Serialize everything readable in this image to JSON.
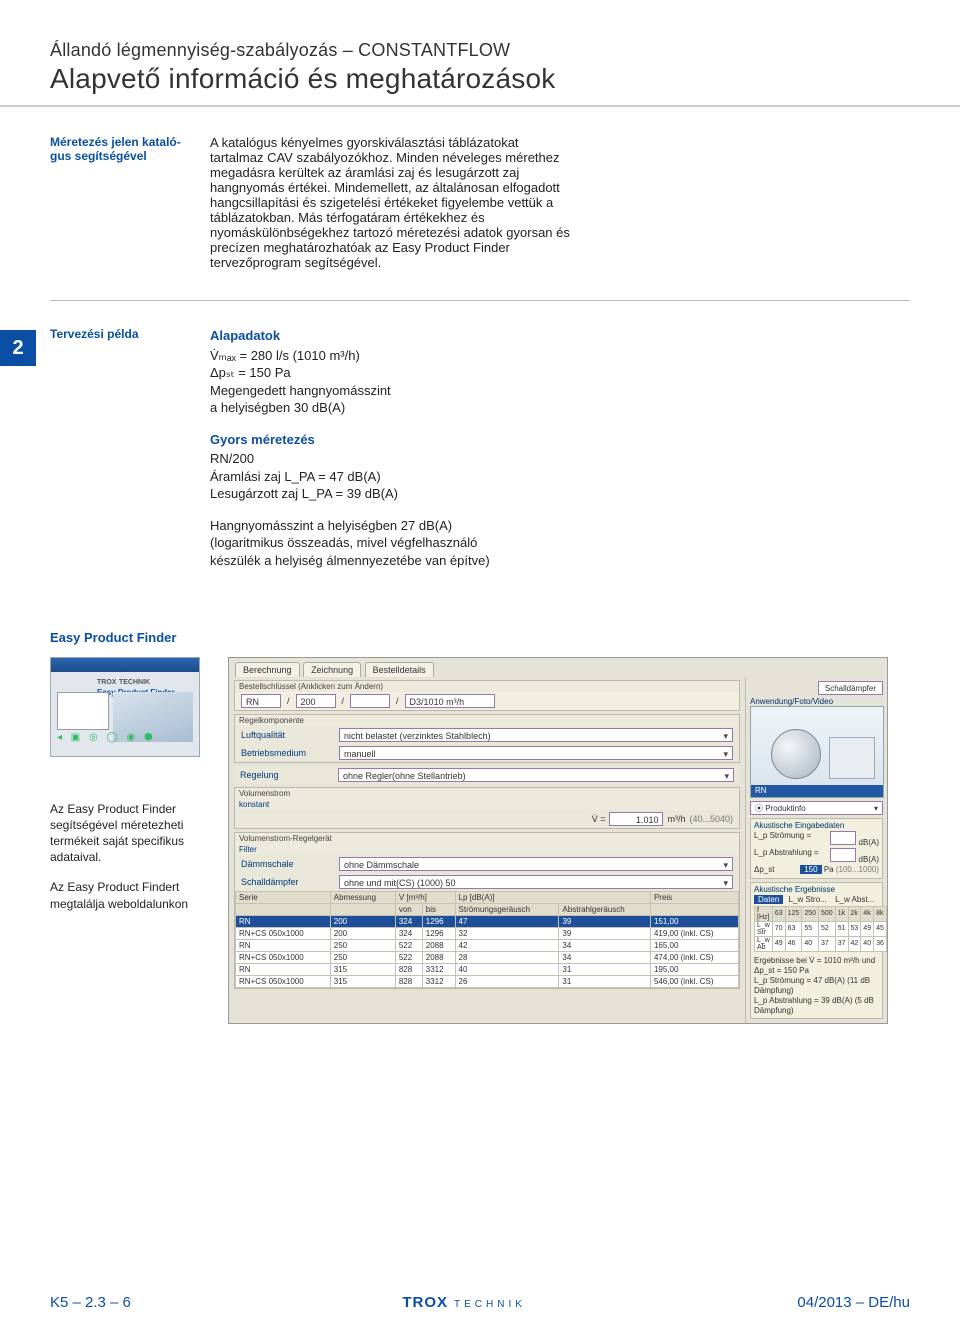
{
  "header": {
    "small": "Állandó légmennyiség-szabályozás – CONSTANTFLOW",
    "big": "Alapvető információ és meghatározások"
  },
  "page_tab": "2",
  "sec1": {
    "label": "Méretezés jelen kataló­gus segítségével",
    "text": "A katalógus kényelmes gyorskiválasztási táblázatokat tartalmaz CAV szabályozókhoz. Minden néveleges mérethez megadásra kerültek az áramlási zaj és lesugárzott zaj hangnyomás értékei. Mindemellett, az általánosan elfogadott hangcsillapítási és szigetelési értékeket figyelembe vettük a táblázatokban. Más térfogatáram értékekhez és nyomáskülönbségekhez tartozó méretezési adatok gyorsan és precízen meghatározhatóak az Easy Product Finder tervezőprogram segítségével."
  },
  "sec2": {
    "label": "Tervezési példa",
    "alap_title": "Alapadatok",
    "alap": {
      "vmax": "V̇ₘₐₓ = 280 l/s (1010 m³/h)",
      "dpst": "Δpₛₜ = 150 Pa",
      "meg1": "Megengedett hangnyomásszint",
      "meg2": "a helyiségben 30 dB(A)"
    },
    "gyors_title": "Gyors méretezés",
    "gyors": {
      "rn": "RN/200",
      "aram": "Áramlási zaj L_PA = 47 dB(A)",
      "lesu": "Lesugárzott zaj L_PA = 39 dB(A)"
    },
    "hang": {
      "l1": "Hangnyomásszint a helyiségben 27 dB(A)",
      "l2": "(logaritmikus összeadás, mivel végfelhasználó",
      "l3": "készülék a helyiség álmennyezetébe van építve)"
    }
  },
  "epf": {
    "heading": "Easy Product Finder",
    "thumb_brand": "TROX",
    "thumb_tech": "TECHNIK",
    "thumb_epf": "Easy Product Finder",
    "cap1": "Az Easy Product Finder segítségével méretezheti termékeit saját specifikus adataival.",
    "cap2": "Az Easy Product Findert megtalálja weboldalunkon"
  },
  "app": {
    "tabs": [
      "Berechnung",
      "Zeichnung",
      "Bestelldetails"
    ],
    "schald_btn": "Schalldämpfer",
    "bs_label": "Bestellschlüssel (Anklicken zum Ändern)",
    "bs_parts": [
      "RN",
      "/",
      "200",
      "/",
      "/",
      "/",
      "D3/1010 m³/h"
    ],
    "grp_regel": "Regelkomponente",
    "luft_label": "Luftqualität",
    "luft_value": "nicht belastet (verzinktes Stahlblech)",
    "betr_label": "Betriebsmedium",
    "betr_value": "manuell",
    "regel_label": "Regelung",
    "regel_value": "ohne Regler(ohne Stellantrieb)",
    "vol_grp": "Volumenstrom",
    "vol_sub": "konstant",
    "vol_veq": "V̇ =",
    "vol_val": "1.010",
    "vol_unit": "m³/h",
    "vol_range": "(40...5040)",
    "anwendung": "Anwendung/Foto/Video",
    "photo_cap": "RN",
    "prodinfo": "⦿ Produktinfo",
    "ak_in": "Akustische Eingabedaten",
    "ak_in_rows": {
      "ls": "L_p Strömung =",
      "ls_u": "dB(A)",
      "la": "L_p Abstrahlung =",
      "la_u": "dB(A)",
      "dp": "Δp_st",
      "dp_val": "150",
      "dp_u": "Pa",
      "dp_range": "(100...1000)"
    },
    "fr_grp": "Volumenstrom-Regelgerät",
    "fr_filter": "Filter",
    "damm_label": "Dämmschale",
    "damm_value": "ohne Dämmschale",
    "schall_label": "Schalldämpfer",
    "schall_value": "ohne und mit(CS) (1000) 50",
    "ak_out": "Akustische Ergebnisse",
    "ak_out_tabs": [
      "Daten",
      "L_w Stro...",
      "L_w Abst..."
    ],
    "spec_head": [
      "f [Hz]",
      "63",
      "125",
      "250",
      "500",
      "1k",
      "2k",
      "4k",
      "8k"
    ],
    "spec_r1": [
      "L_w Str",
      "70",
      "63",
      "55",
      "52",
      "51",
      "53",
      "49",
      "45"
    ],
    "spec_r2": [
      "L_w Ab",
      "49",
      "46",
      "40",
      "37",
      "37",
      "42",
      "40",
      "36"
    ],
    "result_title": "Ergebnisse bei V̇ = 1010 m³/h und Δp_st = 150 Pa",
    "result_l1": "L_p Strömung = 47 dB(A) (11 dB Dämpfung)",
    "result_l2": "L_p Abstrahlung = 39 dB(A) (5 dB Dämpfung)",
    "tbl_head": [
      "Serie",
      "Abmessung",
      "V [m³/h]",
      "",
      "Lp [dB(A)]",
      "",
      "Preis"
    ],
    "tbl_sub": [
      "",
      "",
      "von",
      "bis",
      "Strömungsgeräusch",
      "Abstrahlgeräusch",
      ""
    ],
    "rows": [
      [
        "RN",
        "200",
        "324",
        "1296",
        "47",
        "39",
        "151,00"
      ],
      [
        "RN+CS 050x1000",
        "200",
        "324",
        "1296",
        "32",
        "39",
        "419,00 (inkl. CS)"
      ],
      [
        "RN",
        "250",
        "522",
        "2088",
        "42",
        "34",
        "165,00"
      ],
      [
        "RN+CS 050x1000",
        "250",
        "522",
        "2088",
        "28",
        "34",
        "474,00 (inkl. CS)"
      ],
      [
        "RN",
        "315",
        "828",
        "3312",
        "40",
        "31",
        "195,00"
      ],
      [
        "RN+CS 050x1000",
        "315",
        "828",
        "3312",
        "26",
        "31",
        "546,00 (inkl. CS)"
      ]
    ]
  },
  "footer": {
    "left": "K5 – 2.3 – 6",
    "logo_main": "TROX",
    "logo_sub": "TECHNIK",
    "right": "04/2013 – DE/hu"
  }
}
